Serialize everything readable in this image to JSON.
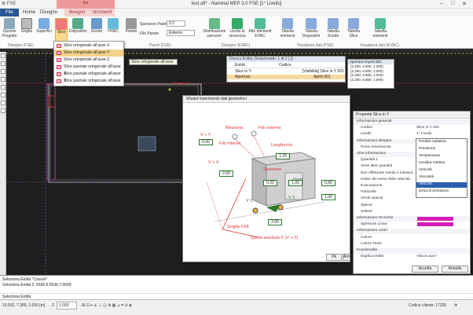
{
  "titlebar": {
    "quick_access": "⊞  FSE",
    "title": "test.afl* - Namirial MEP 3.0 FSE [1° Livello]",
    "context_banner": "fse"
  },
  "tabs": [
    "File",
    "Home",
    "Disegno",
    "disegno",
    "strumenti"
  ],
  "ribbon": {
    "buttons": [
      "Opzioni Progetto",
      "Griglie",
      "Superfici",
      "Slice",
      "Dispositivi",
      "Sonde",
      "HVAC",
      "Parete",
      "Filo Parete",
      "Distribuzione persone",
      "Uscita di sicurezza",
      "Altri elementi EVAC",
      "Tabella elementi",
      "Tabella Dispositivi",
      "Tabella Sonde",
      "Tabella Slice",
      "Tabella elementi"
    ],
    "spessore_label": "Spessore Parete",
    "spessore_value": "0.2",
    "filo_value": "Esterno",
    "groups": [
      "Disegno (FSE)",
      "Pareti (FSE)",
      "Disegno (EVAC)",
      "Visualizza dati (FSE)",
      "Visualizza dati (EVAC)"
    ]
  },
  "slice_menu": [
    "Slice ortogonale all'asse X",
    "Slice ortogonale all'asse Y",
    "Slice ortogonale all'asse Z",
    "Slice parziale ortogonale all'asse X",
    "Slice parziale ortogonale all'asse Y",
    "Slice parziale ortogonale all'asse Z"
  ],
  "tooltip": "Slice ortogonale all'asse Y",
  "elenco": {
    "title": "Elenco Entità (Selezionate: 1 di 2 [ ])",
    "col_entita": "Entità",
    "col_codice": "Codice",
    "rows": [
      {
        "entita": "Slice in Y",
        "codice": "[Visibilità] Slice in Y 001"
      },
      {
        "entita": "Apertura",
        "codice": "Apert 001"
      }
    ]
  },
  "aperture": {
    "header": "Apertura #Apert 001",
    "rows": [
      "(2.200, 4.800, 1.000)",
      "(2.200, 6.800, 1.000)",
      "(2.200, 4.800, 1.000)",
      "(2.200, 6.800, 1.000)"
    ]
  },
  "canvas_tag": "Slice in Y",
  "wizard": {
    "title": "Wizard inserimento dati geometrici",
    "labels": {
      "mezzeria": "Mezzeria",
      "filo_esterno": "Filo esterno",
      "filo_interno": "Filo interno",
      "lunghezza": "Lunghezza",
      "spessore": "Spessore",
      "vy": "V + Y",
      "vx": "V + X",
      "griglia": "Griglia FSE",
      "quota": "Quota assoluta Z (V + Z)",
      "vnum": "V 1",
      "vnum2": "V 2",
      "nodo": "Nodo"
    },
    "fields": [
      "0.00",
      "2.00",
      "1.20",
      "0.20",
      "1.00",
      "6.80",
      "1.00",
      "3.00"
    ],
    "ok": "Ok",
    "annulla": "Annulla"
  },
  "props": {
    "title": "Proprietà Slice in Y",
    "rows": [
      {
        "k": "Informazioni generali",
        "v": "",
        "sec": true
      },
      {
        "k": "Codice",
        "v": "Slice in Y 001",
        "sec": false
      },
      {
        "k": "Livello",
        "v": "1° Livello",
        "sec": false
      },
      {
        "k": "Informazioni disegno",
        "v": "",
        "sec": true
      },
      {
        "k": "Punto inserimento",
        "v": "",
        "sec": false
      },
      {
        "k": "Altre informazioni",
        "v": "",
        "sec": true
      },
      {
        "k": "Quantità 1",
        "v": "Velocità",
        "sec": false
      },
      {
        "k": "Serie altre quantità",
        "v": "",
        "sec": false
      },
      {
        "k": "Non effettuare media e interpol...",
        "v": "",
        "sec": false
      },
      {
        "k": "Indice del verso della velocità",
        "v": "",
        "sec": false
      },
      {
        "k": "Evacuazione",
        "v": "",
        "sec": false
      },
      {
        "k": "Particella",
        "v": "",
        "sec": false
      },
      {
        "k": "Verde Specie",
        "v": "",
        "sec": false
      },
      {
        "k": "Specie",
        "v": "",
        "sec": false
      },
      {
        "k": "Vettore",
        "v": "",
        "sec": false
      },
      {
        "k": "Informazioni Tecniche",
        "v": "",
        "sec": true
      },
      {
        "k": "Spessore Linea",
        "v": "",
        "sec": false
      },
      {
        "k": "Informazioni colori",
        "v": "",
        "sec": true
      },
      {
        "k": "Colore",
        "v": "",
        "sec": false
      },
      {
        "k": "Colore Testo",
        "v": "",
        "sec": false
      },
      {
        "k": "Funzionalità",
        "v": "",
        "sec": true
      },
      {
        "k": "Duplica entità",
        "v": "<dicce.aux>",
        "sec": false
      }
    ],
    "qty_options": [
      "Perdita radiativa",
      "Pressione",
      "Temperatura",
      "Umidità relativa",
      "Velocità",
      "Viscosità",
      "Velocità",
      "Zona di pressione"
    ],
    "qty_selected": 6,
    "accetta": "Accetta",
    "annulla": "Annulla",
    "swatch_color": "#d21fb8"
  },
  "command": {
    "line1": "Seleziona Entità \"Cancel\"",
    "line2": "Seleziona Entità 2: 6536.6 6536.7:0000",
    "line3": "Seleziona Entità"
  },
  "status": {
    "coords": "10.552, 7.389, 1.000 [m]",
    "z_label": "Z",
    "z_value": "1.000",
    "codice": "Codice cliente: 17335"
  }
}
